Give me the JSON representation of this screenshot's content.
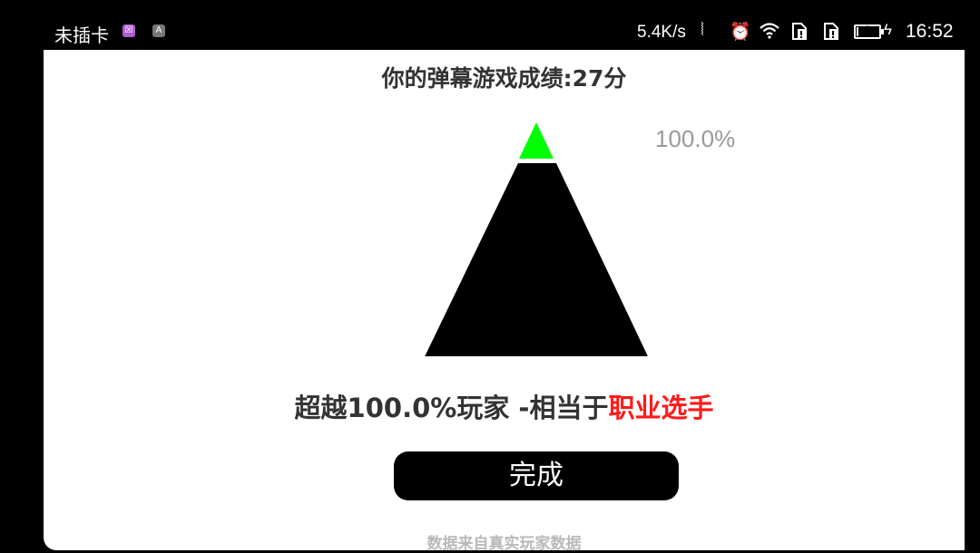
{
  "status_bar": {
    "carrier": "未插卡",
    "notif_icons": [
      {
        "name": "app-notification-icon",
        "glyph": "☒",
        "color": "#b05fd0"
      },
      {
        "name": "a-notification-icon",
        "glyph": "A",
        "color": "#777777"
      }
    ],
    "net_speed": "5.4K/s",
    "battery_level": "9",
    "battery_fraction": 0.09,
    "time": "16:52"
  },
  "score_title": "你的弹幕游戏成绩:27分",
  "pyramid": {
    "percent_label": "100.0%",
    "fill_fraction": 1.0,
    "tip_color": "#00ff00",
    "body_color": "#000000"
  },
  "result": {
    "prefix": "超越100.0%玩家 -相当于",
    "rank": "职业选手",
    "rank_color": "#ff1a1a"
  },
  "done_button": "完成",
  "footer_note": "数据来自真实玩家数据"
}
